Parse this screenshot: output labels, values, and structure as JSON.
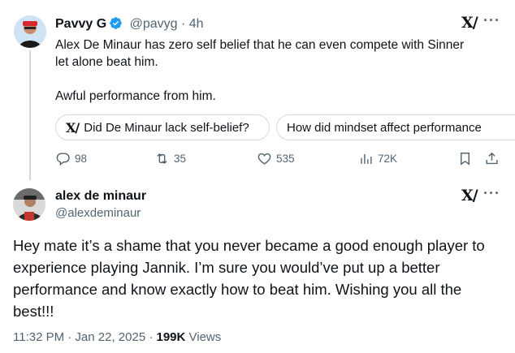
{
  "original": {
    "display_name": "Pavvy G",
    "handle": "@pavyg",
    "time": "· 4h",
    "text_line1": "Alex De Minaur has zero self belief that he can even compete with Sinner",
    "text_line2": "let alone beat him.",
    "text_line3": "Awful performance from him.",
    "chips": [
      "Did De Minaur lack self-belief?",
      "How did mindset affect performance"
    ],
    "actions": {
      "replies": "98",
      "reposts": "35",
      "likes": "535",
      "views": "72K"
    }
  },
  "reply": {
    "display_name": "alex de minaur",
    "handle": "@alexdeminaur",
    "text_line1": "Hey mate it’s a shame that you never became a good enough player to",
    "text_line2": "experience playing Jannik. I’m sure you would’ve put up a better",
    "text_line3": "performance and know exactly how to beat him. Wishing you all the",
    "text_line4": "best!!!",
    "timestamp": "11:32 PM · Jan 22, 2025 · ",
    "views_count": "199K",
    "views_label": " Views"
  },
  "icons": {
    "grok": "X/",
    "more": "···"
  },
  "colors": {
    "verified": "#1d9bf0",
    "muted": "#536471",
    "border": "#cfd9de"
  }
}
